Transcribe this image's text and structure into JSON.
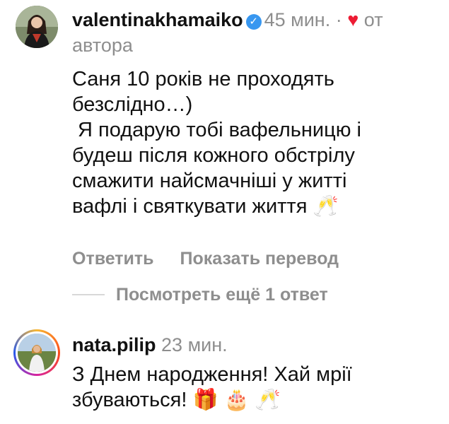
{
  "comments": [
    {
      "username": "valentinakhamaiko",
      "time": "45 мин.",
      "separator": "·",
      "liked_by_author_line1": "от",
      "liked_by_author_line2": "автора",
      "text_lines": [
        "Саня 10 років не проходять",
        "безслідно…)",
        " Я подарую тобі вафельницю і",
        "будеш після кожного обстрілу",
        "смажити найсмачніші у житті",
        "вафлі і святкувати життя 🥂"
      ],
      "reply_label": "Ответить",
      "translate_label": "Показать перевод",
      "more_replies_label": "Посмотреть ещё 1 ответ"
    },
    {
      "username": "nata.pilip",
      "time": "23 мин.",
      "text_lines": [
        "З Днем народження! Хай мрії",
        "збуваються! 🎁 🎂 🥂"
      ]
    }
  ],
  "icons": {
    "verified": "verified-badge-icon",
    "heart": "heart-icon"
  },
  "colors": {
    "secondary_text": "#8e8e8e",
    "heart": "#ed1c34",
    "verified": "#3897f0"
  }
}
